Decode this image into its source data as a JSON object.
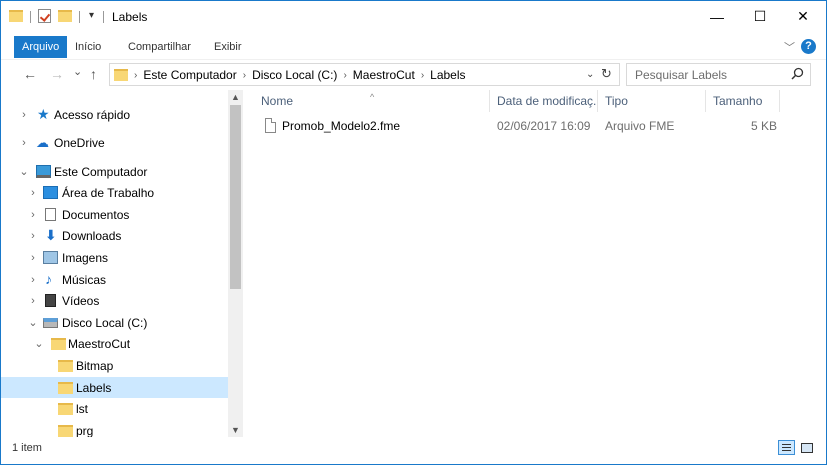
{
  "window": {
    "title": "Labels",
    "buttons": {
      "minimize": "—",
      "maximize": "☐",
      "close": "✕"
    },
    "accent_color": "#1979ca"
  },
  "quick_access_toolbar": {
    "dropdown": "▾"
  },
  "ribbon": {
    "tabs": [
      {
        "label": "Arquivo",
        "active": true
      },
      {
        "label": "Início",
        "active": false
      },
      {
        "label": "Compartilhar",
        "active": false
      },
      {
        "label": "Exibir",
        "active": false
      }
    ],
    "expand_icon": "﹀",
    "help_label": "?"
  },
  "navigation": {
    "back": "←",
    "forward": "→",
    "recent": "⌄",
    "up": "↑",
    "breadcrumbs": [
      "Este Computador",
      "Disco Local (C:)",
      "MaestroCut",
      "Labels"
    ],
    "breadcrumb_separator": "›",
    "address_dropdown": "⌄",
    "refresh": "↻"
  },
  "search": {
    "placeholder": "Pesquisar Labels",
    "value": ""
  },
  "tree": [
    {
      "label": "Acesso rápido",
      "icon": "star-icon",
      "chevron": "›",
      "indent": 0
    },
    {
      "label": "OneDrive",
      "icon": "cloud-icon",
      "chevron": "›",
      "indent": 0
    },
    {
      "label": "Este Computador",
      "icon": "computer-icon",
      "chevron": "⌄",
      "indent": 0
    },
    {
      "label": "Área de Trabalho",
      "icon": "desktop-icon",
      "chevron": "›",
      "indent": 1
    },
    {
      "label": "Documentos",
      "icon": "documents-icon",
      "chevron": "›",
      "indent": 1
    },
    {
      "label": "Downloads",
      "icon": "downloads-icon",
      "chevron": "›",
      "indent": 1
    },
    {
      "label": "Imagens",
      "icon": "pictures-icon",
      "chevron": "›",
      "indent": 1
    },
    {
      "label": "Músicas",
      "icon": "music-icon",
      "chevron": "›",
      "indent": 1
    },
    {
      "label": "Vídeos",
      "icon": "videos-icon",
      "chevron": "›",
      "indent": 1
    },
    {
      "label": "Disco Local (C:)",
      "icon": "drive-icon",
      "chevron": "⌄",
      "indent": 1
    },
    {
      "label": "MaestroCut",
      "icon": "folder-icon",
      "chevron": "⌄",
      "indent": 2
    },
    {
      "label": "Bitmap",
      "icon": "folder-icon",
      "chevron": "",
      "indent": 3
    },
    {
      "label": "Labels",
      "icon": "folder-icon",
      "chevron": "",
      "indent": 3,
      "selected": true
    },
    {
      "label": "lst",
      "icon": "folder-icon",
      "chevron": "",
      "indent": 3
    },
    {
      "label": "prg",
      "icon": "folder-icon",
      "chevron": "",
      "indent": 3
    }
  ],
  "scrollbar": {
    "up": "▲",
    "down": "▼"
  },
  "file_list": {
    "columns": [
      "Nome",
      "Data de modificaç...",
      "Tipo",
      "Tamanho"
    ],
    "sort_indicator": "^",
    "rows": [
      {
        "name": "Promob_Modelo2.fme",
        "modified": "02/06/2017 16:09",
        "type": "Arquivo FME",
        "size": "5 KB"
      }
    ]
  },
  "status_bar": {
    "item_count": "1 item"
  }
}
